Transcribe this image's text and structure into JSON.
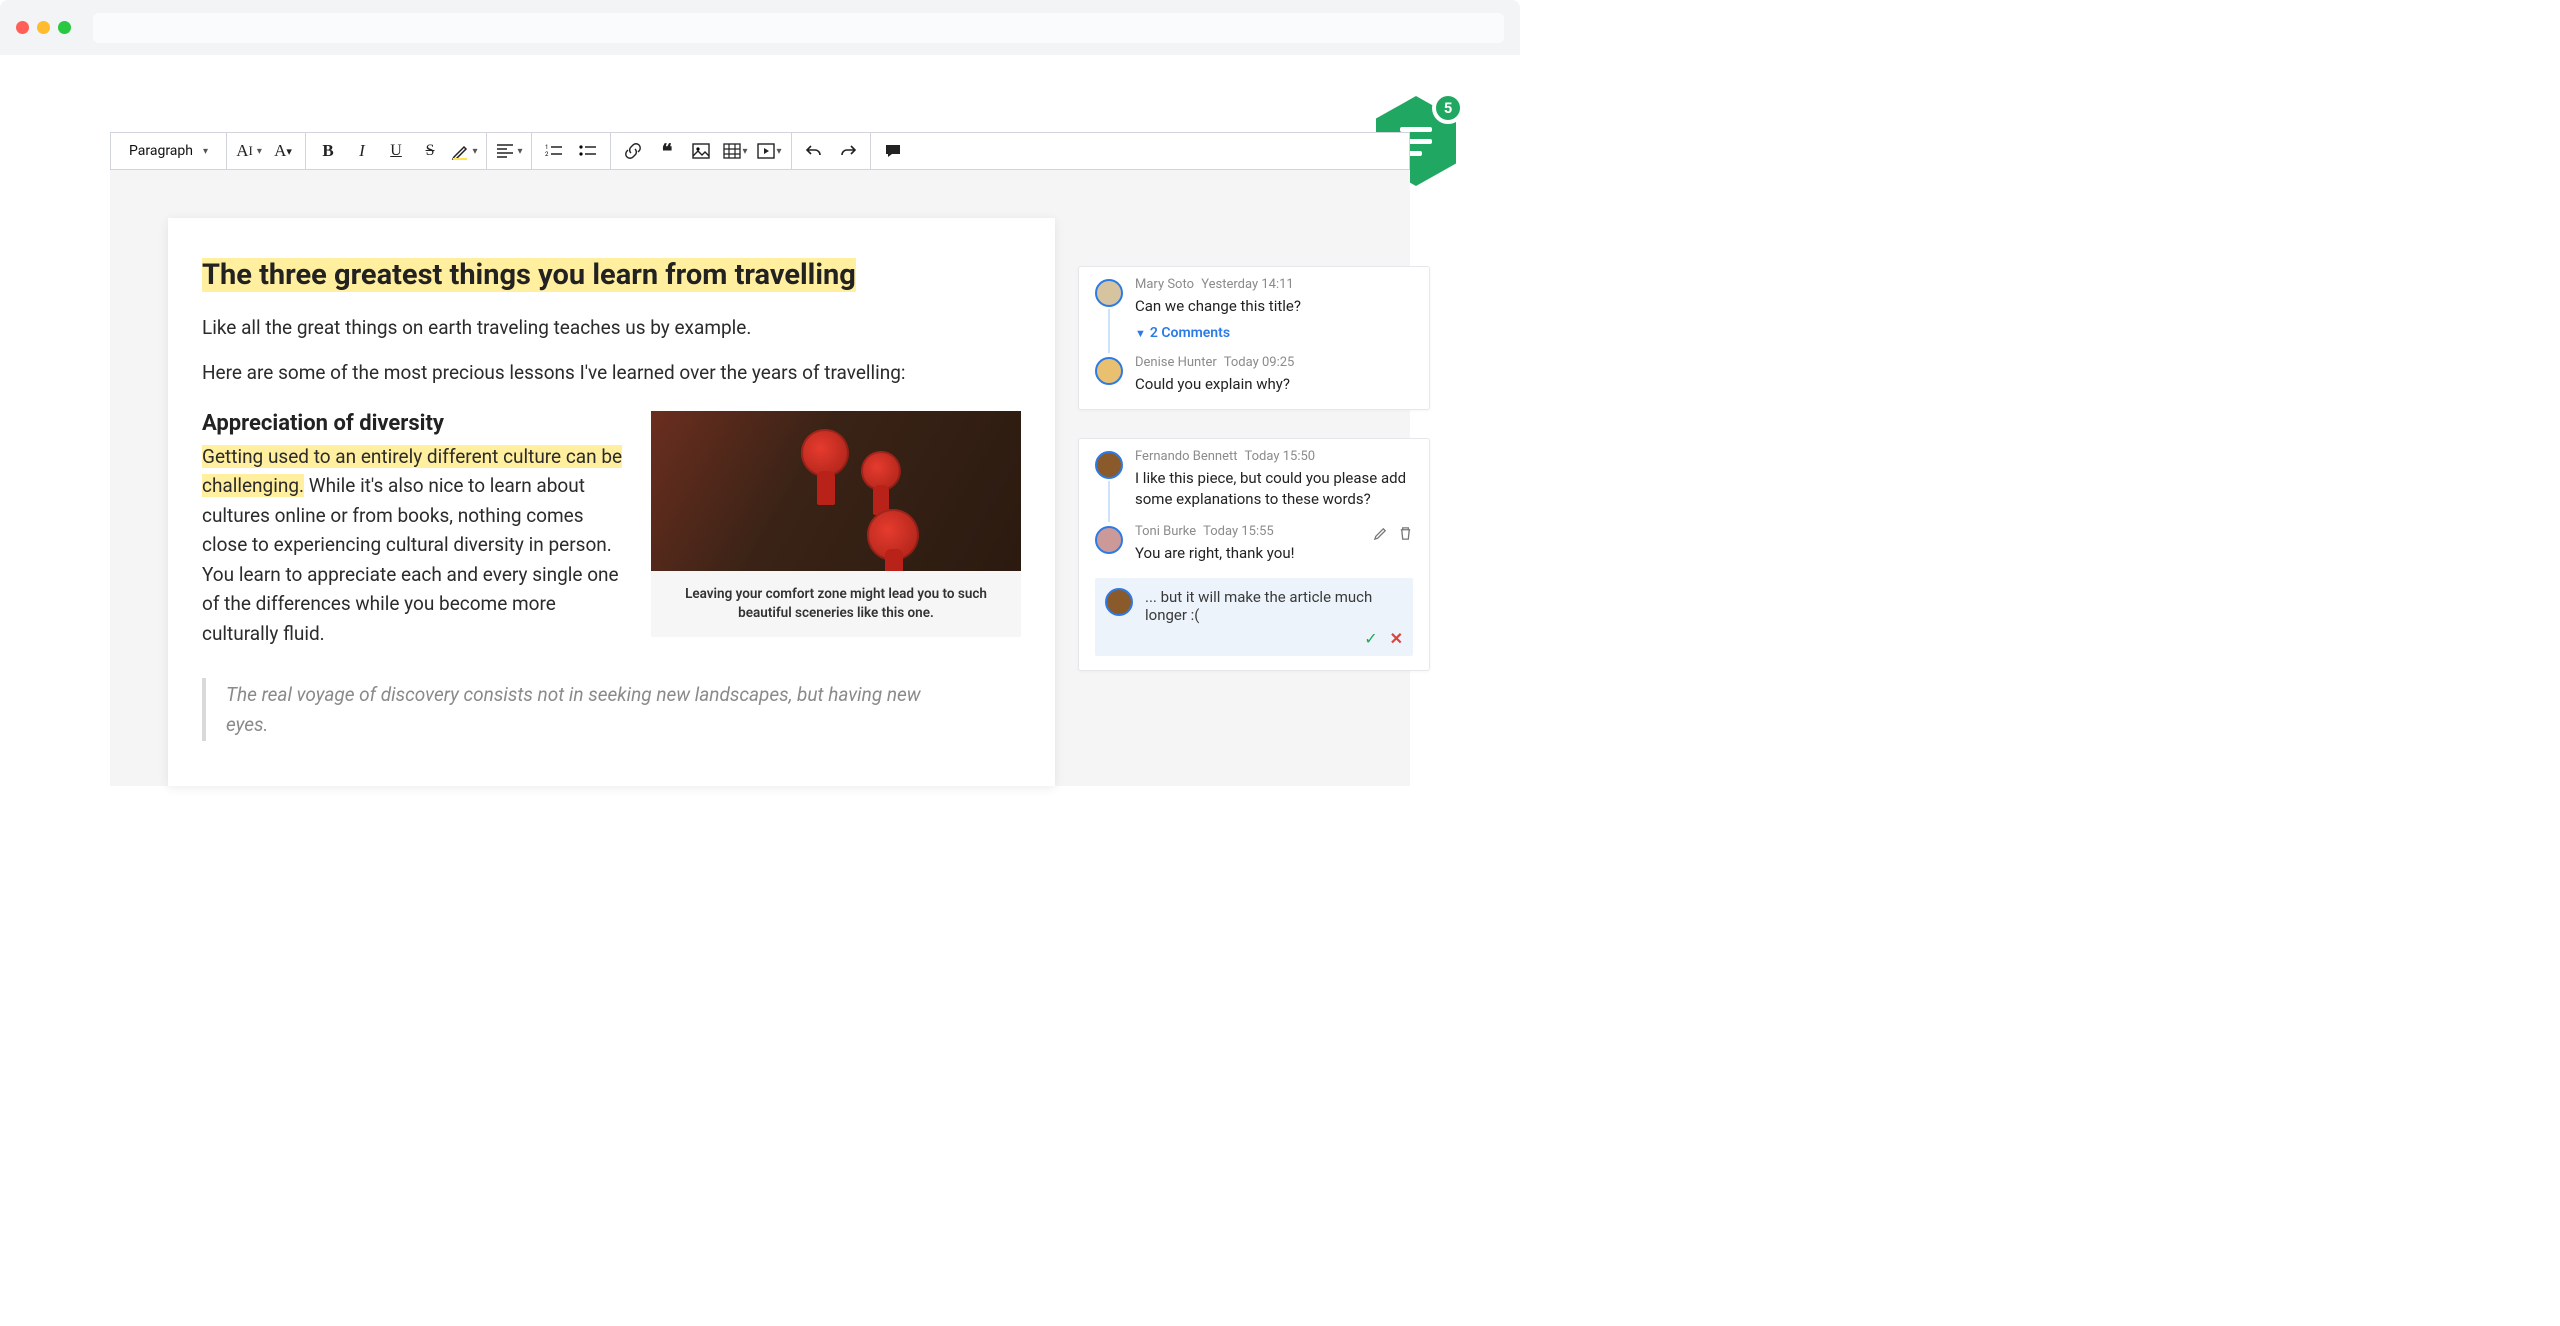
{
  "toolbar": {
    "paragraph_label": "Paragraph"
  },
  "fab_badge": "5",
  "doc": {
    "title": "The three greatest things you learn from travelling",
    "intro": "Like all the great things on earth traveling teaches us by example.",
    "intro2": "Here are some of the most precious lessons I've learned over the years of travelling:",
    "h2": "Appreciation of diversity",
    "p1_hl": "Getting used to an entirely different culture can be challenging.",
    "p1_rest": " While it's also nice to learn about cultures online or from books, nothing comes close to experiencing cultural diversity in person. You learn to appreciate each and every single one of the differences while you become more culturally fluid.",
    "caption": "Leaving your comfort zone might lead you to such beautiful sceneries like this one.",
    "quote": "The real voyage of discovery consists not in seeking new landscapes, but having new eyes."
  },
  "threads": [
    {
      "comments": [
        {
          "author": "Mary Soto",
          "time": "Yesterday 14:11",
          "text": "Can we change this title?",
          "replies_label": "2 Comments"
        },
        {
          "author": "Denise Hunter",
          "time": "Today 09:25",
          "text": "Could you explain why?"
        }
      ]
    },
    {
      "comments": [
        {
          "author": "Fernando Bennett",
          "time": "Today 15:50",
          "text": "I like this piece, but could you please add some explanations to these words?"
        },
        {
          "author": "Toni Burke",
          "time": "Today 15:55",
          "text": "You are right, thank you!"
        }
      ],
      "draft": "... but it will make the article much longer :("
    }
  ]
}
